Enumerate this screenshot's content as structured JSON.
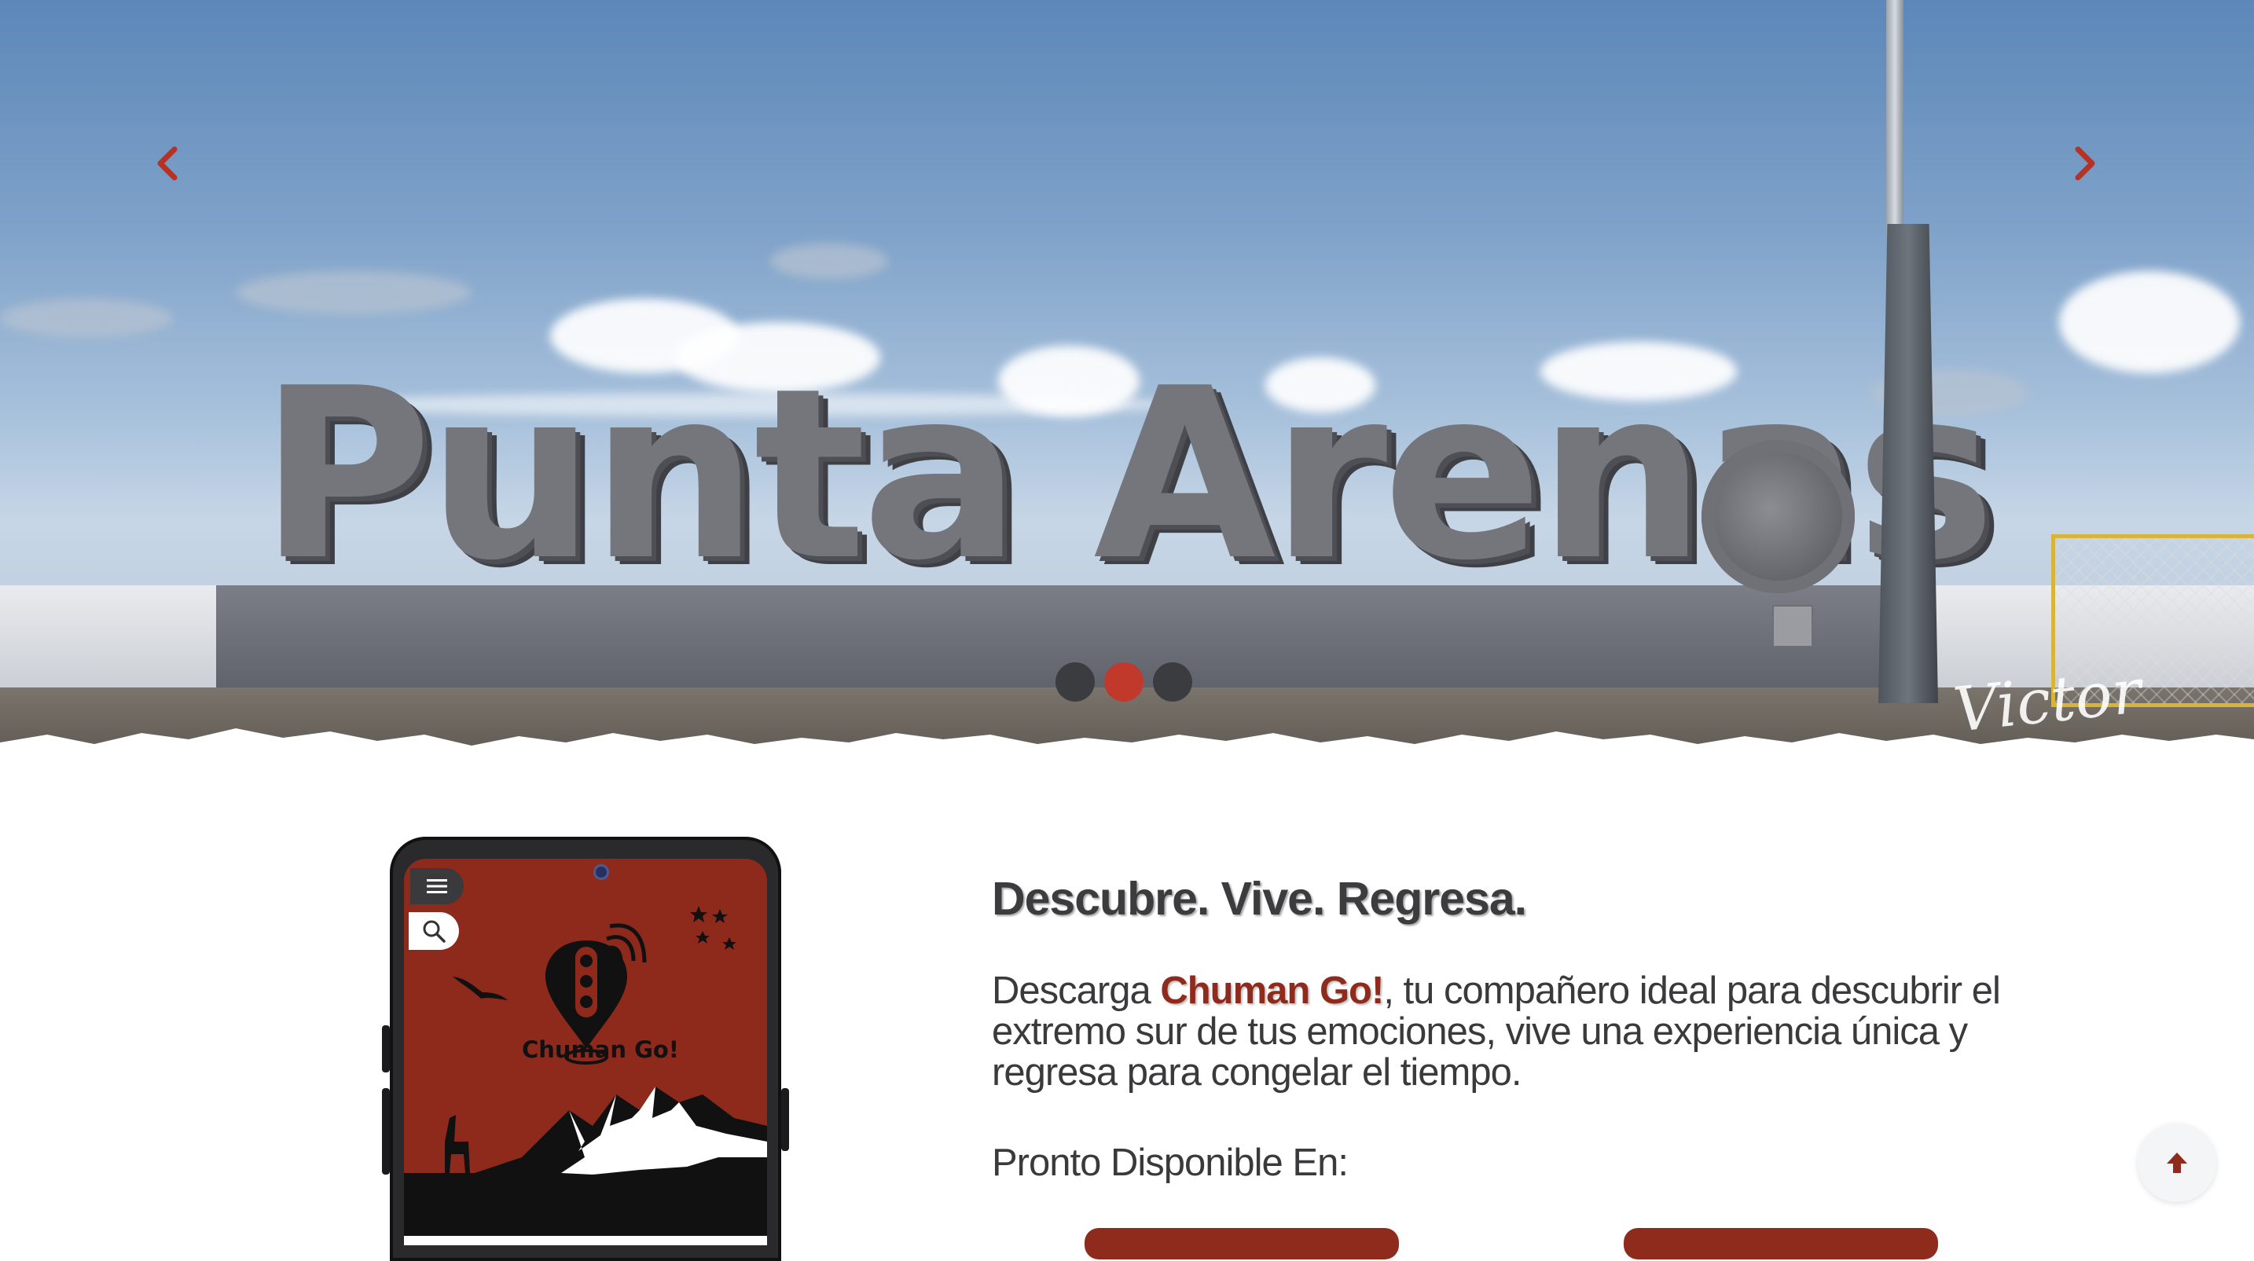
{
  "hero": {
    "sign_text": "Punta Arenas",
    "prev_icon": "chevron-left-icon",
    "next_icon": "chevron-right-icon",
    "slides_count": 3,
    "active_slide": 2
  },
  "app_screen": {
    "app_name": "Chuman Go!",
    "menu_icon": "hamburger-menu-icon",
    "search_icon": "search-icon"
  },
  "content": {
    "tagline": "Descubre. Vive. Regresa.",
    "desc_prefix": "Descarga ",
    "brand": "Chuman Go!",
    "desc_suffix": ", tu compañero ideal para descubrir el extremo sur de tus emociones, vive una experiencia única y regresa para congelar el tiempo.",
    "availability": "Pronto Disponible En:"
  },
  "colors": {
    "accent": "#8f2b1c",
    "dot_active": "#c0392b",
    "dot_inactive": "#3b3c40",
    "text": "#3a3a3d"
  },
  "back_to_top_icon": "arrow-up-icon"
}
